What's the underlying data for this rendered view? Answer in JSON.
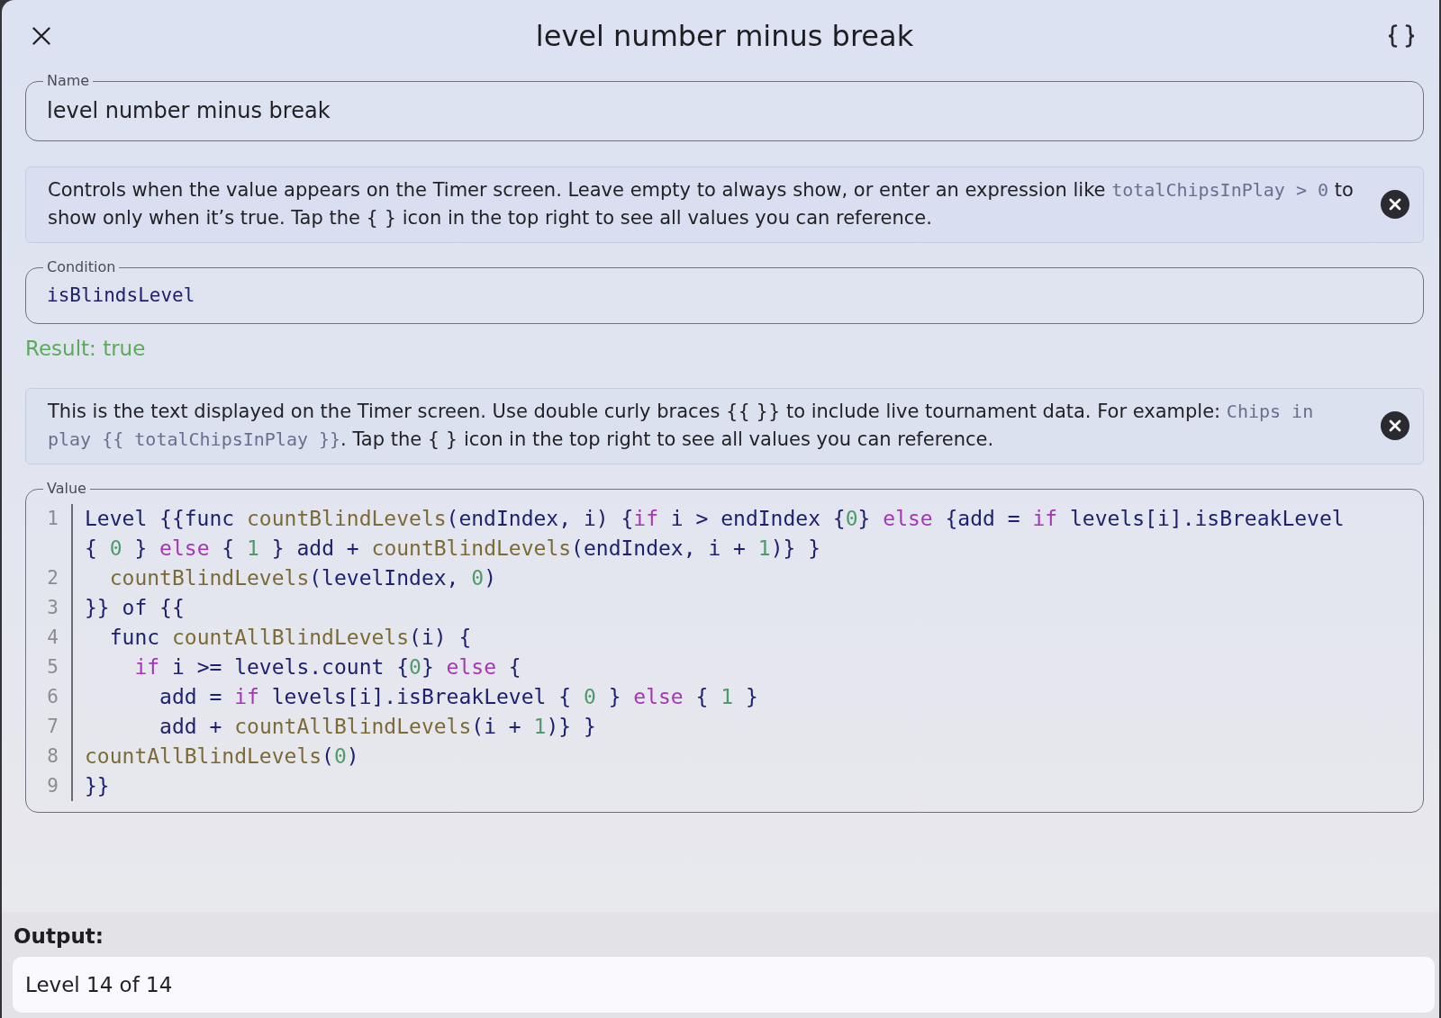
{
  "header": {
    "title": "level number minus break"
  },
  "name_field": {
    "label": "Name",
    "value": "level number minus break"
  },
  "condition_hint": {
    "segments": [
      {
        "kind": "text",
        "text": "Controls when the value appears on the Timer screen. Leave empty to always show, or enter an expression like "
      },
      {
        "kind": "code",
        "text": "totalChipsInPlay > 0"
      },
      {
        "kind": "text",
        "text": " to show only when it’s true. Tap the { } icon in the top right to see all values you can reference."
      }
    ]
  },
  "condition_field": {
    "label": "Condition",
    "value": "isBlindsLevel"
  },
  "result": {
    "text": "Result: true",
    "valid": true
  },
  "value_hint": {
    "segments": [
      {
        "kind": "text",
        "text": "This is the text displayed on the Timer screen. Use double curly braces {{ }} to include live tournament data. For example: "
      },
      {
        "kind": "code",
        "text": "Chips in play {{ totalChipsInPlay }}"
      },
      {
        "kind": "text",
        "text": ". Tap the { } icon in the top right to see all values you can reference."
      }
    ]
  },
  "value_editor": {
    "label": "Value",
    "lines": [
      {
        "number": "1",
        "tokens": [
          {
            "kind": "plain",
            "text": "Level {{func "
          },
          {
            "kind": "function",
            "text": "countBlindLevels"
          },
          {
            "kind": "plain",
            "text": "(endIndex, i) {"
          },
          {
            "kind": "keyword",
            "text": "if"
          },
          {
            "kind": "plain",
            "text": " i > endIndex {"
          },
          {
            "kind": "number",
            "text": "0"
          },
          {
            "kind": "plain",
            "text": "} "
          },
          {
            "kind": "keyword",
            "text": "else"
          },
          {
            "kind": "plain",
            "text": " {add = "
          },
          {
            "kind": "keyword",
            "text": "if"
          },
          {
            "kind": "plain",
            "text": " levels[i].isBreakLevel { "
          },
          {
            "kind": "number",
            "text": "0"
          },
          {
            "kind": "plain",
            "text": " } "
          },
          {
            "kind": "keyword",
            "text": "else"
          },
          {
            "kind": "plain",
            "text": " { "
          },
          {
            "kind": "number",
            "text": "1"
          },
          {
            "kind": "plain",
            "text": " } add + "
          },
          {
            "kind": "function",
            "text": "countBlindLevels"
          },
          {
            "kind": "plain",
            "text": "(endIndex, i + "
          },
          {
            "kind": "number",
            "text": "1"
          },
          {
            "kind": "plain",
            "text": ")} }"
          }
        ]
      },
      {
        "number": "2",
        "tokens": [
          {
            "kind": "function",
            "text": "  countBlindLevels"
          },
          {
            "kind": "plain",
            "text": "(levelIndex, "
          },
          {
            "kind": "number",
            "text": "0"
          },
          {
            "kind": "plain",
            "text": ")"
          }
        ]
      },
      {
        "number": "3",
        "tokens": [
          {
            "kind": "plain",
            "text": "}} of {{"
          }
        ]
      },
      {
        "number": "4",
        "tokens": [
          {
            "kind": "plain",
            "text": "  func "
          },
          {
            "kind": "function",
            "text": "countAllBlindLevels"
          },
          {
            "kind": "plain",
            "text": "(i) {"
          }
        ]
      },
      {
        "number": "5",
        "tokens": [
          {
            "kind": "keyword",
            "text": "    if"
          },
          {
            "kind": "plain",
            "text": " i >= levels.count {"
          },
          {
            "kind": "number",
            "text": "0"
          },
          {
            "kind": "plain",
            "text": "} "
          },
          {
            "kind": "keyword",
            "text": "else"
          },
          {
            "kind": "plain",
            "text": " {"
          }
        ]
      },
      {
        "number": "6",
        "tokens": [
          {
            "kind": "plain",
            "text": "      add = "
          },
          {
            "kind": "keyword",
            "text": "if"
          },
          {
            "kind": "plain",
            "text": " levels[i].isBreakLevel { "
          },
          {
            "kind": "number",
            "text": "0"
          },
          {
            "kind": "plain",
            "text": " } "
          },
          {
            "kind": "keyword",
            "text": "else"
          },
          {
            "kind": "plain",
            "text": " { "
          },
          {
            "kind": "number",
            "text": "1"
          },
          {
            "kind": "plain",
            "text": " }"
          }
        ]
      },
      {
        "number": "7",
        "tokens": [
          {
            "kind": "plain",
            "text": "      add + "
          },
          {
            "kind": "function",
            "text": "countAllBlindLevels"
          },
          {
            "kind": "plain",
            "text": "(i + "
          },
          {
            "kind": "number",
            "text": "1"
          },
          {
            "kind": "plain",
            "text": ")} }"
          }
        ]
      },
      {
        "number": "8",
        "tokens": [
          {
            "kind": "function",
            "text": "countAllBlindLevels"
          },
          {
            "kind": "plain",
            "text": "("
          },
          {
            "kind": "number",
            "text": "0"
          },
          {
            "kind": "plain",
            "text": ")"
          }
        ]
      },
      {
        "number": "9",
        "tokens": [
          {
            "kind": "plain",
            "text": "}}"
          }
        ]
      }
    ]
  },
  "output": {
    "label": "Output:",
    "value": "Level 14 of 14"
  }
}
